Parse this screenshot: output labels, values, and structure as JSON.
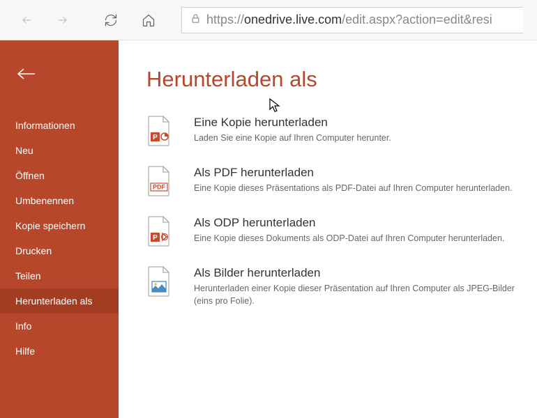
{
  "browser": {
    "url": "https://onedrive.live.com/edit.aspx?action=edit&resi"
  },
  "page_title": "Herunterladen als",
  "sidebar": {
    "items": [
      {
        "label": "Informationen",
        "active": false
      },
      {
        "label": "Neu",
        "active": false
      },
      {
        "label": "Öffnen",
        "active": false
      },
      {
        "label": "Umbenennen",
        "active": false
      },
      {
        "label": "Kopie speichern",
        "active": false
      },
      {
        "label": "Drucken",
        "active": false
      },
      {
        "label": "Teilen",
        "active": false
      },
      {
        "label": "Herunterladen als",
        "active": true
      },
      {
        "label": "Info",
        "active": false
      },
      {
        "label": "Hilfe",
        "active": false
      }
    ]
  },
  "options": [
    {
      "icon": "ppt",
      "title": "Eine Kopie herunterladen",
      "desc": "Laden Sie eine Kopie auf Ihren Computer herunter."
    },
    {
      "icon": "pdf",
      "title": "Als PDF herunterladen",
      "desc": "Eine Kopie dieses Präsentations als PDF-Datei auf Ihren Computer herunterladen."
    },
    {
      "icon": "odp",
      "title": "Als ODP herunterladen",
      "desc": "Eine Kopie dieses Dokuments als ODP-Datei auf Ihren Computer herunterladen."
    },
    {
      "icon": "img",
      "title": "Als Bilder herunterladen",
      "desc": "Herunterladen einer Kopie dieser Präsentation auf Ihren Computer als JPEG-Bilder (eins pro Folie)."
    }
  ]
}
